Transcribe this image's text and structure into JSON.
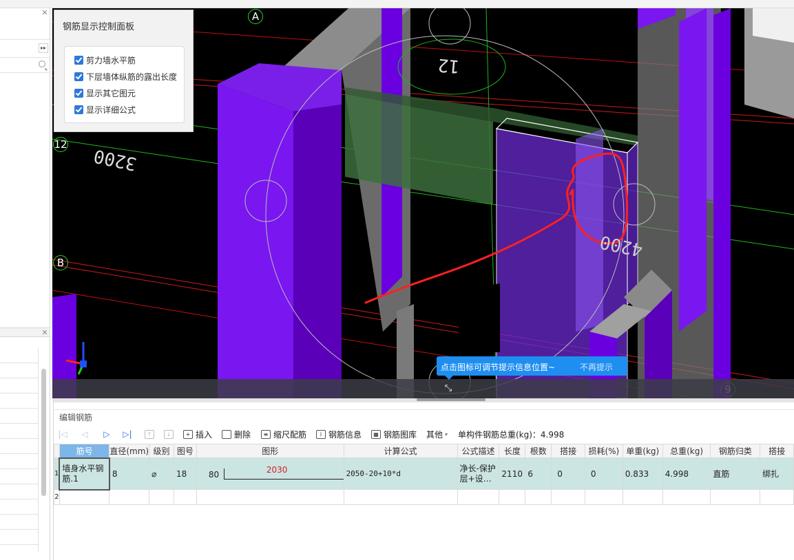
{
  "viewport": {
    "grid_labels": {
      "a": "A",
      "b": "B",
      "n12": "12",
      "n9": "9"
    },
    "dims": {
      "d3200": "3200",
      "d12": "12",
      "d4200": "4200"
    }
  },
  "control_panel": {
    "title": "钢筋显示控制面板",
    "options": [
      {
        "label": "剪力墙水平筋",
        "checked": true
      },
      {
        "label": "下层墙体纵筋的露出长度",
        "checked": true
      },
      {
        "label": "显示其它图元",
        "checked": true
      },
      {
        "label": "显示详细公式",
        "checked": true
      }
    ]
  },
  "hint": {
    "text": "点击图标可调节提示信息位置~",
    "dismiss": "不再提示"
  },
  "editor": {
    "title": "编辑钢筋",
    "toolbar": {
      "insert": "插入",
      "delete": "删除",
      "scale": "缩尺配筋",
      "info": "钢筋信息",
      "library": "钢筋图库",
      "other": "其他",
      "total": "单构件钢筋总重(kg)：4.998"
    },
    "columns": [
      "筋号",
      "直径(mm)",
      "级别",
      "图号",
      "图形",
      "计算公式",
      "公式描述",
      "长度",
      "根数",
      "搭接",
      "损耗(%)",
      "单重(kg)",
      "总重(kg)",
      "钢筋归类",
      "搭接"
    ],
    "rows": [
      {
        "no": "1",
        "name": "墙身水平钢筋.1",
        "diameter": "8",
        "grade": "⌀",
        "fig": "18",
        "shape_left": "80",
        "shape_len": "2030",
        "formula": "2050-20+10*d",
        "desc": "净长-保护层+设…",
        "length": "2110",
        "count": "6",
        "lap": "0",
        "loss": "0",
        "unit_w": "0.833",
        "total_w": "4.998",
        "category": "直筋",
        "lap_type": "绑扎"
      }
    ],
    "empty_row_no": "2"
  },
  "colors": {
    "purple": "#6a00e0",
    "accent": "#1f8ef1",
    "selected_row": "#cbe5e3"
  }
}
